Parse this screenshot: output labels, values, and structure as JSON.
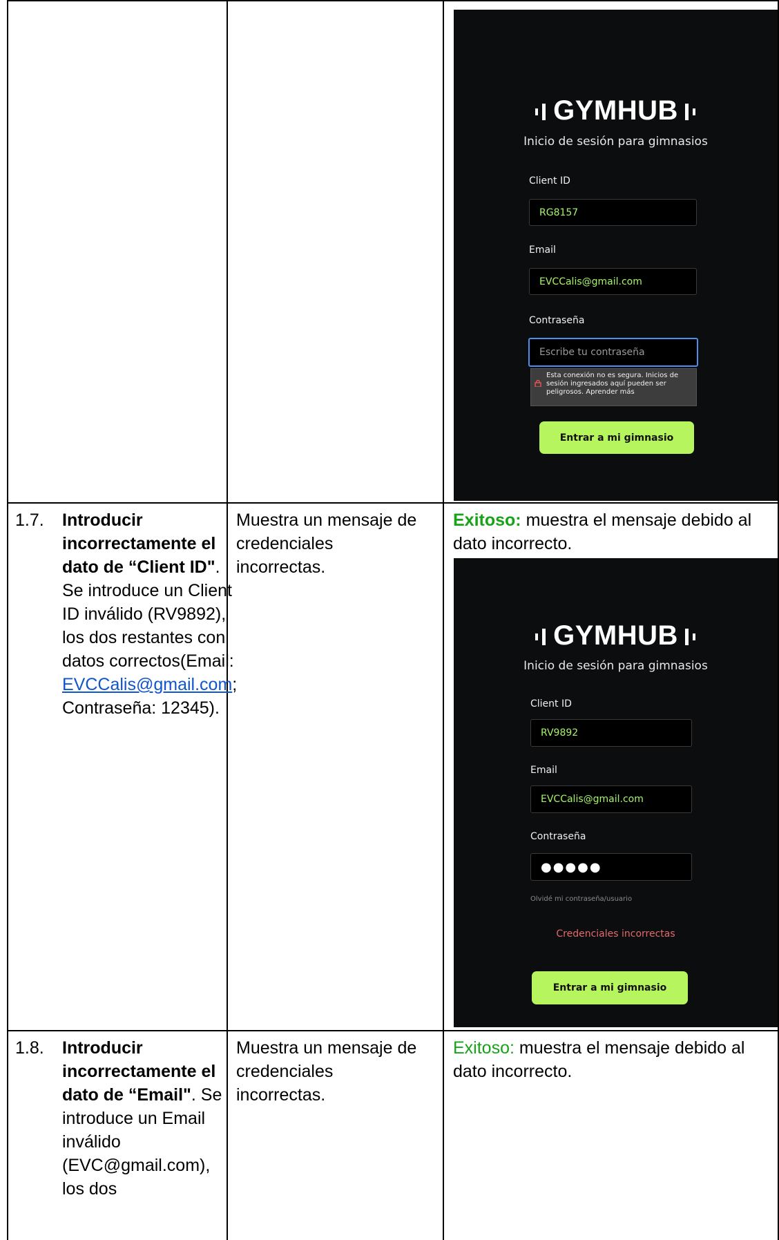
{
  "row_top": {
    "screenshot": {
      "brand": "GYMHUB",
      "subtitle": "Inicio de sesión para gimnasios",
      "client_id_label": "Client ID",
      "client_id_value": "RG8157",
      "email_label": "Email",
      "email_value": "EVCCalis@gmail.com",
      "password_label": "Contraseña",
      "password_placeholder": "Escribe tu contraseña",
      "tooltip_text": "Esta conexión no es segura. Inicios de sesión ingresados aquí pueden ser peligrosos. Aprender más",
      "button_label": "Entrar a mi gimnasio"
    }
  },
  "row_17": {
    "number": "1.7.",
    "step_bold_1": "Introducir incorrectamente el dato de “Client ID\"",
    "step_text_1": ". Se introduce un Client ID inválido (RV9892), los dos restantes con datos correctos(Email: ",
    "step_link": "EVCCalis@gmail.com",
    "step_text_2": "; Contraseña: 12345).",
    "expected": "Muestra un mensaje de credenciales incorrectas.",
    "result_label": "Exitoso:",
    "result_text": " muestra el mensaje debido al dato incorrecto.",
    "screenshot": {
      "brand": "GYMHUB",
      "subtitle": "Inicio de sesión para gimnasios",
      "client_id_label": "Client ID",
      "client_id_value": "RV9892",
      "email_label": "Email",
      "email_value": "EVCCalis@gmail.com",
      "password_label": "Contraseña",
      "password_value": "●●●●●",
      "forgot": "Olvidé mi contraseña/usuario",
      "error": "Credenciales incorrectas",
      "button_label": "Entrar a mi gimnasio"
    }
  },
  "row_18": {
    "number": "1.8.",
    "step_bold_1": "Introducir incorrectamente el dato de “Email\"",
    "step_text_1": ". Se introduce un Email inválido (EVC@gmail.com), los dos",
    "expected": "Muestra un mensaje de credenciales incorrectas.",
    "result_label": "Exitoso:",
    "result_text": " muestra el mensaje debido al dato incorrecto."
  }
}
